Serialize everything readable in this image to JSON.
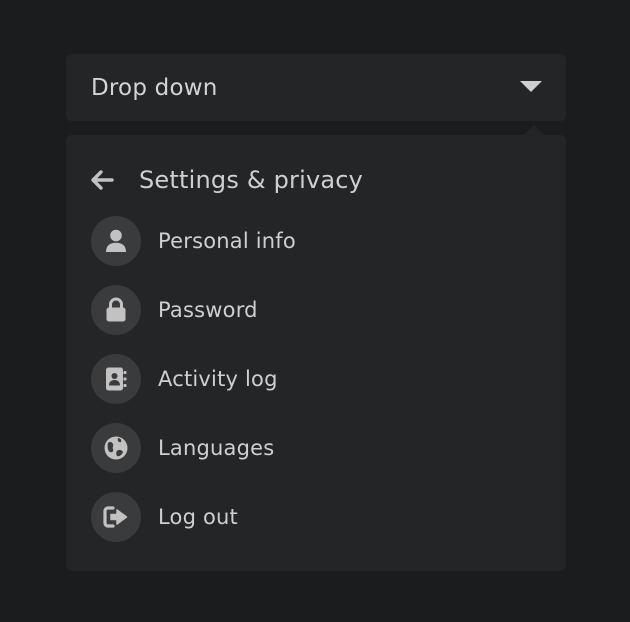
{
  "dropdown": {
    "label": "Drop down",
    "caret_icon": "caret-down-icon"
  },
  "menu": {
    "header": {
      "back_icon": "arrow-left-icon",
      "title": "Settings & privacy"
    },
    "items": [
      {
        "label": "Personal info",
        "icon": "user-icon"
      },
      {
        "label": "Password",
        "icon": "lock-icon"
      },
      {
        "label": "Activity log",
        "icon": "address-book-icon"
      },
      {
        "label": "Languages",
        "icon": "globe-icon"
      },
      {
        "label": "Log out",
        "icon": "sign-out-icon"
      }
    ]
  },
  "colors": {
    "background": "#1b1c1e",
    "surface": "#242527",
    "icon_circle": "#3a3b3d",
    "text": "#cfcfd0",
    "icon": "#c2c2c3"
  }
}
